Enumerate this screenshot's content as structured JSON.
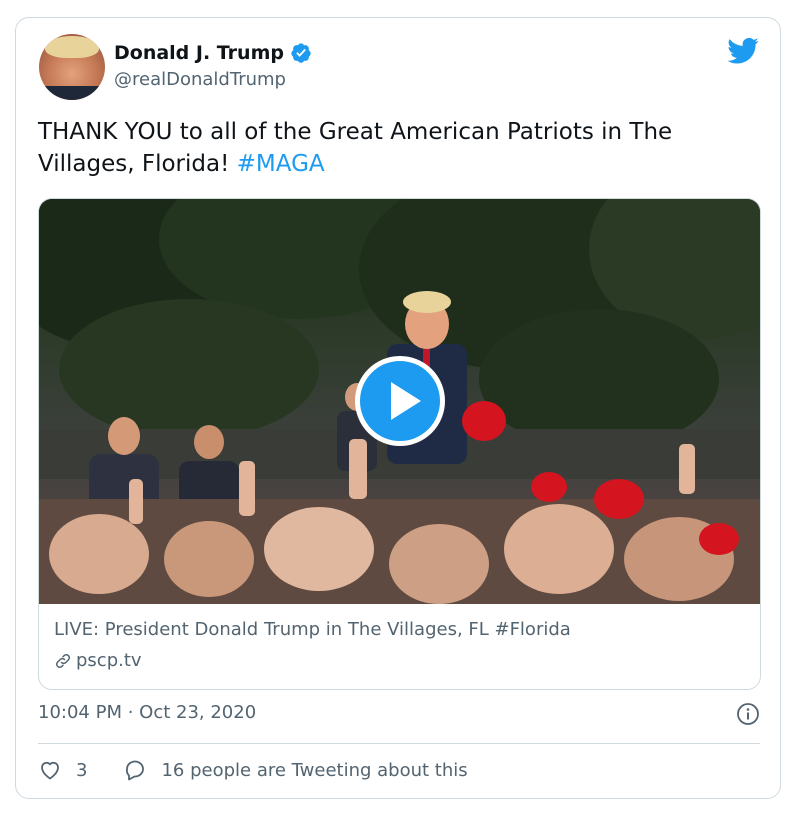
{
  "author": {
    "name": "Donald J. Trump",
    "handle": "@realDonaldTrump",
    "verified": true
  },
  "tweet": {
    "text": "THANK YOU to all of the Great American Patriots in The Villages, Florida!",
    "hashtag": "#MAGA"
  },
  "link_card": {
    "title": "LIVE: President Donald Trump in The Villages, FL #Florida",
    "domain": "pscp.tv"
  },
  "timestamp": "10:04 PM · Oct 23, 2020",
  "actions": {
    "likes_count": "3",
    "tweeting_label": "16 people are Tweeting about this"
  },
  "colors": {
    "accent": "#1d9bf0",
    "secondary_text": "#536471",
    "border": "#cfd9de"
  },
  "icons": [
    "verified-badge-icon",
    "twitter-bird-icon",
    "play-icon",
    "link-icon",
    "info-icon",
    "heart-icon",
    "reply-bubble-icon"
  ]
}
